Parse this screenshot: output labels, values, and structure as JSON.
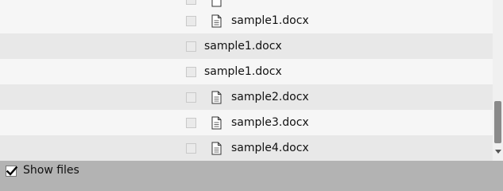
{
  "tree": {
    "rows": [
      {
        "label": "sample1.docx"
      },
      {
        "label": "sample1.docx"
      },
      {
        "label": "sample1.docx"
      },
      {
        "label": "sample2.docx"
      },
      {
        "label": "sample3.docx"
      },
      {
        "label": "sample4.docx"
      }
    ]
  },
  "footer": {
    "show_files_label": "Show files",
    "show_files_checked": true
  },
  "icons": {
    "file": "document-file-icon",
    "checkbox": "checkbox-icon",
    "checkmark": "checkmark-icon"
  }
}
